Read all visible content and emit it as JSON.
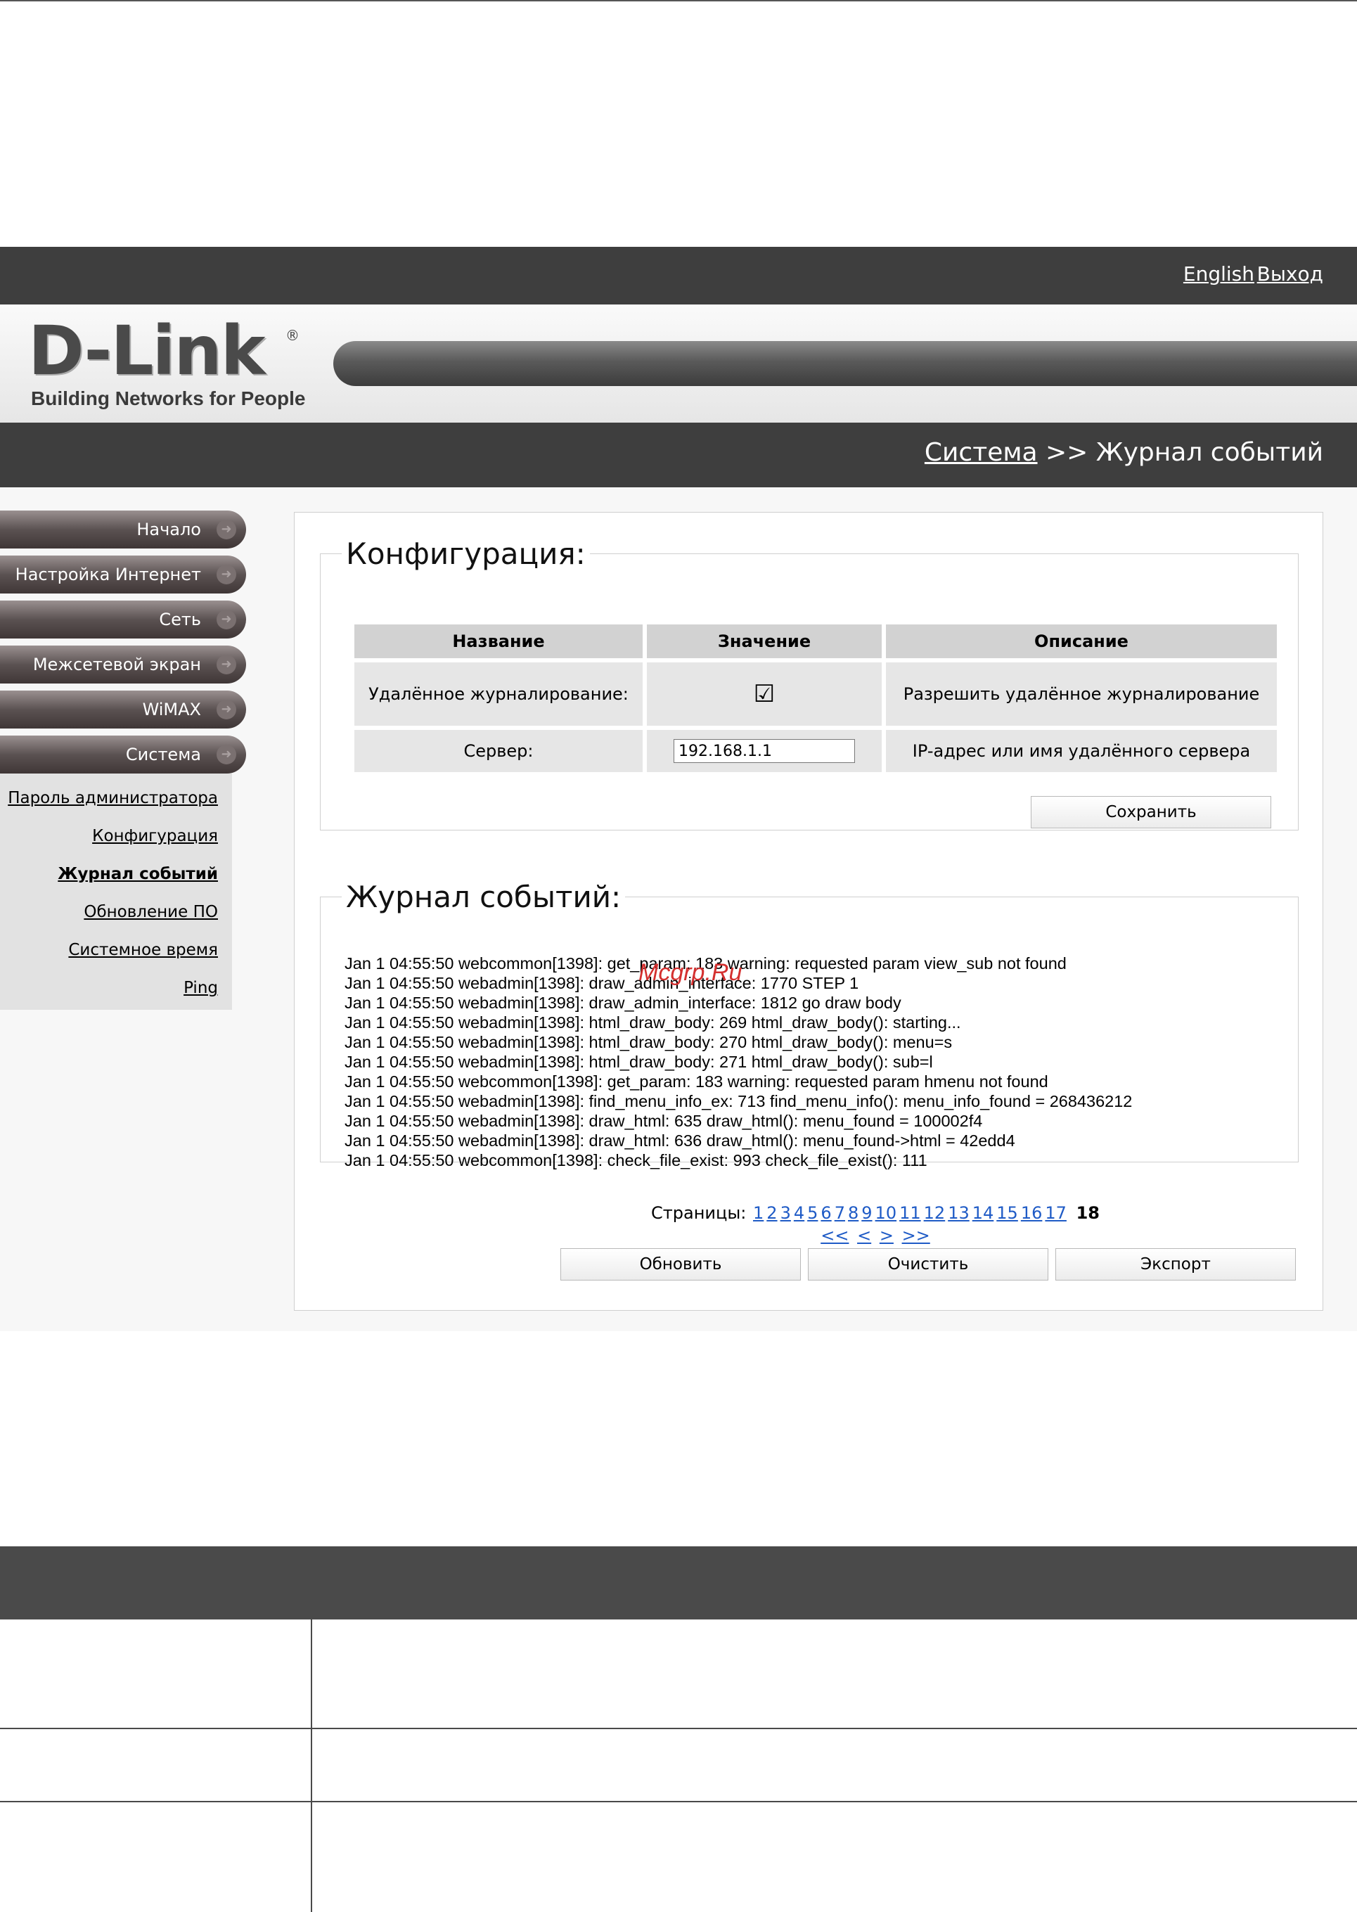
{
  "topbar": {
    "english_label": "English",
    "exit_label": "Выход"
  },
  "logo": {
    "brand": "D-Link",
    "registered": "®",
    "tagline": "Building Networks for People"
  },
  "breadcrumb": {
    "section": "Система",
    "separator": ">>",
    "current": "Журнал событий"
  },
  "sidebar": {
    "items": [
      {
        "label": "Начало"
      },
      {
        "label": "Настройка Интернет"
      },
      {
        "label": "Сеть"
      },
      {
        "label": "Межсетевой экран"
      },
      {
        "label": "WiMAX"
      },
      {
        "label": "Система"
      }
    ],
    "subitems": [
      {
        "label": "Пароль администратора"
      },
      {
        "label": "Конфигурация"
      },
      {
        "label": "Журнал событий"
      },
      {
        "label": "Обновление ПО"
      },
      {
        "label": "Системное время"
      },
      {
        "label": "Ping"
      }
    ]
  },
  "config": {
    "legend": "Конфигурация:",
    "headers": {
      "name": "Название",
      "value": "Значение",
      "description": "Описание"
    },
    "rows": [
      {
        "name": "Удалённое журналирование:",
        "checked": true,
        "description": "Разрешить удалённое журналирование"
      },
      {
        "name": "Сервер:",
        "value": "192.168.1.1",
        "description": "IP-адрес или имя удалённого сервера"
      }
    ],
    "save_label": "Сохранить"
  },
  "log": {
    "legend": "Журнал событий:",
    "watermark": "Mcgrp.Ru",
    "lines": [
      "Jan 1 04:55:50 webcommon[1398]: get_param: 183 warning: requested param view_sub not found",
      "Jan 1 04:55:50 webadmin[1398]: draw_admin_interface: 1770 STEP 1",
      "Jan 1 04:55:50 webadmin[1398]: draw_admin_interface: 1812 go draw body",
      "Jan 1 04:55:50 webadmin[1398]: html_draw_body: 269 html_draw_body(): starting...",
      "Jan 1 04:55:50 webadmin[1398]: html_draw_body: 270 html_draw_body(): menu=s",
      "Jan 1 04:55:50 webadmin[1398]: html_draw_body: 271 html_draw_body(): sub=l",
      "Jan 1 04:55:50 webcommon[1398]: get_param: 183 warning: requested param hmenu not found",
      "Jan 1 04:55:50 webadmin[1398]: find_menu_info_ex: 713 find_menu_info(): menu_info_found = 268436212",
      "Jan 1 04:55:50 webadmin[1398]: draw_html: 635 draw_html(): menu_found = 100002f4",
      "Jan 1 04:55:50 webadmin[1398]: draw_html: 636 draw_html(): menu_found->html = 42edd4",
      "Jan 1 04:55:50 webcommon[1398]: check_file_exist: 993 check_file_exist(): 111"
    ]
  },
  "pager": {
    "label": "Страницы:",
    "pages": [
      "1",
      "2",
      "3",
      "4",
      "5",
      "6",
      "7",
      "8",
      "9",
      "10",
      "11",
      "12",
      "13",
      "14",
      "15",
      "16",
      "17"
    ],
    "current": "18",
    "first": "<<",
    "prev": "<",
    "next": ">",
    "last": ">>"
  },
  "actions": {
    "refresh_label": "Обновить",
    "clear_label": "Очистить",
    "export_label": "Экспорт"
  }
}
